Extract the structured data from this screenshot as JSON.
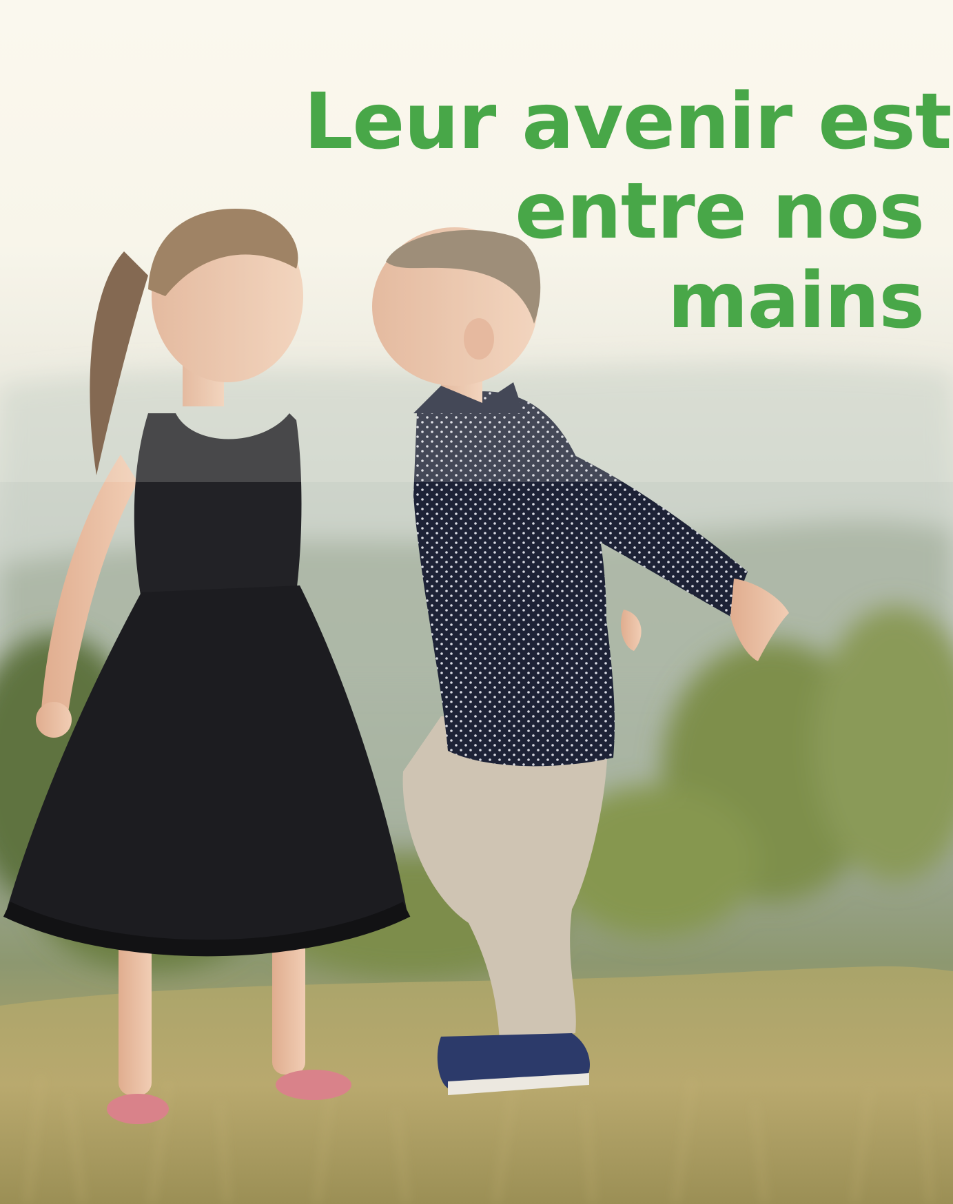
{
  "headline": {
    "lines": [
      "Leur avenir est",
      "entre nos",
      "mains"
    ],
    "color": "#48a748"
  },
  "photo": {
    "subject": "girl-and-boy-icon"
  }
}
